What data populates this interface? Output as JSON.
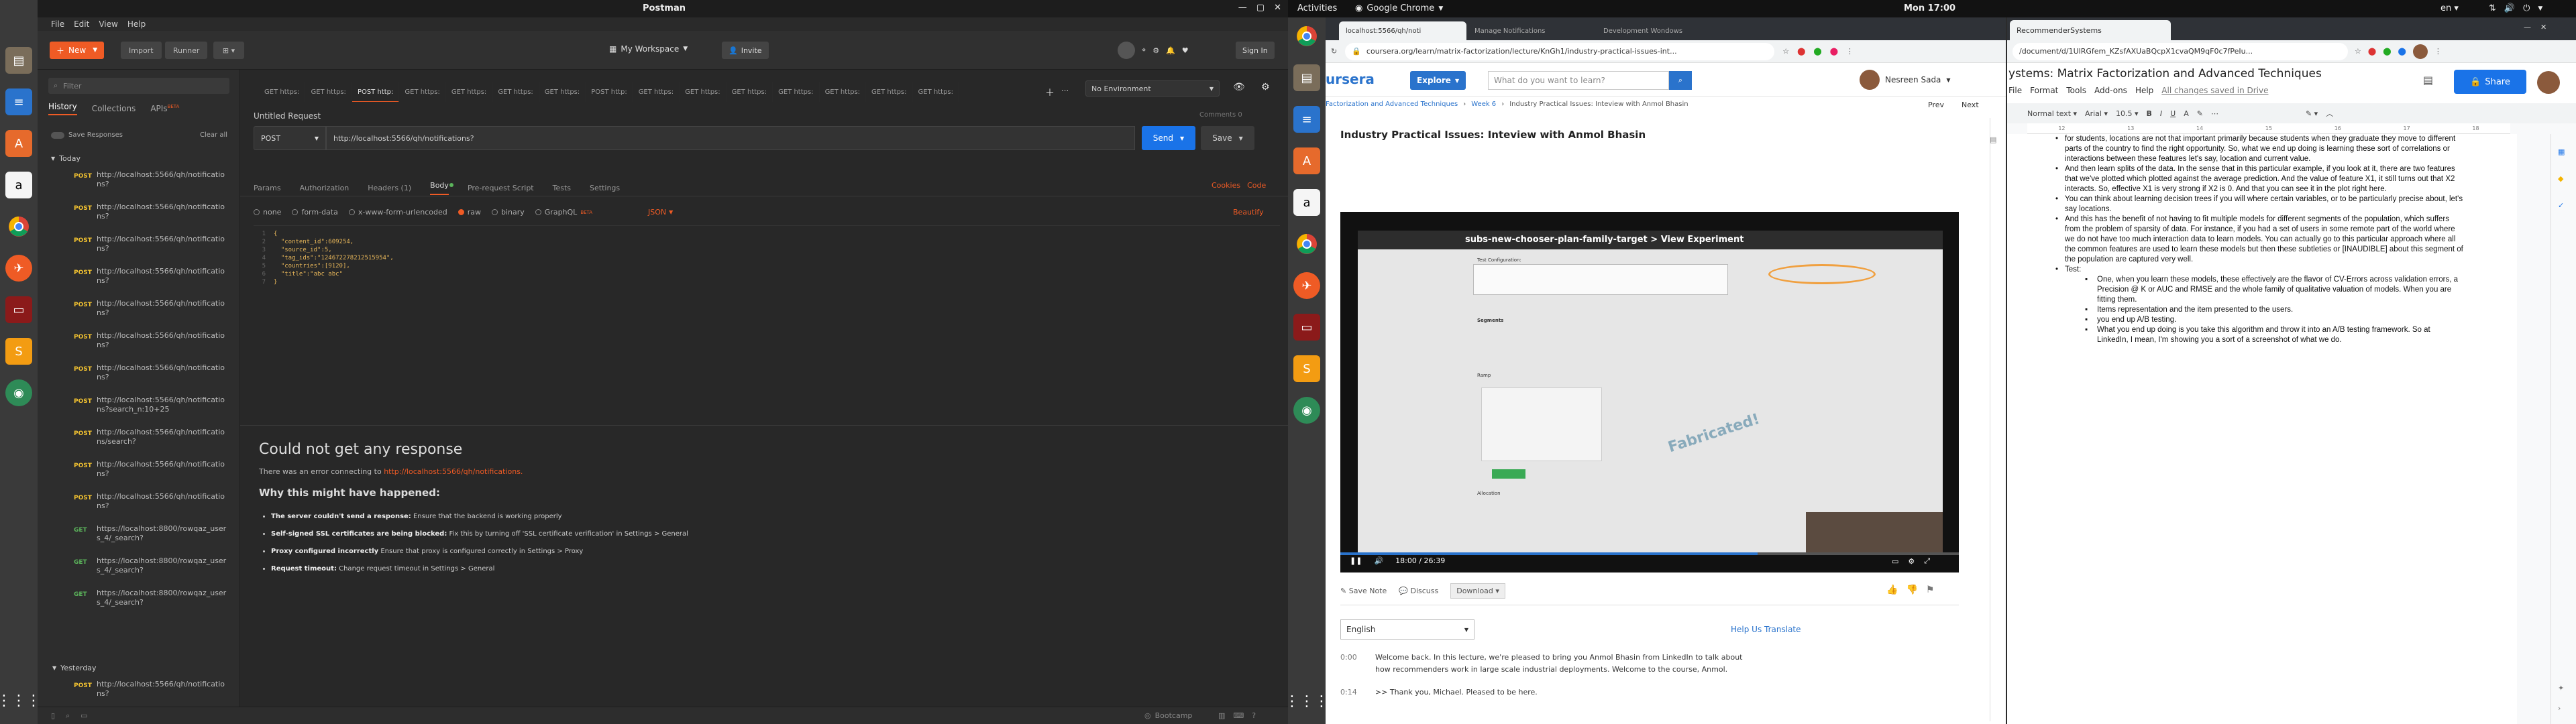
{
  "system": {
    "activities": "Activities",
    "app_menu": "Google Chrome",
    "clock": "Mon 17:00",
    "lang": "en"
  },
  "postman": {
    "title": "Postman",
    "menu": [
      "File",
      "Edit",
      "View",
      "Help"
    ],
    "new_label": "New",
    "import_label": "Import",
    "runner_label": "Runner",
    "workspace": "My Workspace",
    "invite": "Invite",
    "signin": "Sign In",
    "filter_placeholder": "Filter",
    "side_tabs": [
      "History",
      "Collections",
      "APIs"
    ],
    "beta": "BETA",
    "save_responses": "Save Responses",
    "clear_all": "Clear all",
    "today": "Today",
    "yesterday": "Yesterday",
    "history": [
      {
        "method": "POST",
        "url": "http://localhost:5566/qh/notificatio ns?"
      },
      {
        "method": "POST",
        "url": "http://localhost:5566/qh/notificatio ns?"
      },
      {
        "method": "POST",
        "url": "http://localhost:5566/qh/notificatio ns?"
      },
      {
        "method": "POST",
        "url": "http://localhost:5566/qh/notificatio ns?"
      },
      {
        "method": "POST",
        "url": "http://localhost:5566/qh/notificatio ns?"
      },
      {
        "method": "POST",
        "url": "http://localhost:5566/qh/notificatio ns?"
      },
      {
        "method": "POST",
        "url": "http://localhost:5566/qh/notificatio ns?"
      },
      {
        "method": "POST",
        "url": "http://localhost:5566/qh/notificatio ns?search_n:10+25"
      },
      {
        "method": "POST",
        "url": "http://localhost:5566/qh/notificatio ns/search?"
      },
      {
        "method": "POST",
        "url": "http://localhost:5566/qh/notificatio ns?"
      },
      {
        "method": "POST",
        "url": "http://localhost:5566/qh/notificatio ns?"
      },
      {
        "method": "GET",
        "url": "https://localhost:8800/rowqaz_user s_4/_search?"
      },
      {
        "method": "GET",
        "url": "https://localhost:8800/rowqaz_user s_4/_search?"
      },
      {
        "method": "GET",
        "url": "https://localhost:8800/rowqaz_user s_4/_search?"
      }
    ],
    "yesterday_item": {
      "method": "POST",
      "url": "http://localhost:5566/qh/notificatio ns?"
    },
    "tabs": [
      "GET https:",
      "GET https:",
      "POST http:",
      "GET https:",
      "GET https:",
      "GET https:",
      "GET https:",
      "POST http:",
      "GET https:",
      "GET https:",
      "GET https:",
      "GET https:",
      "GET https:",
      "GET https:",
      "GET https:"
    ],
    "environment": "No Environment",
    "request_name": "Untitled Request",
    "comments": "Comments 0",
    "method": "POST",
    "url": "http://localhost:5566/qh/notifications?",
    "send": "Send",
    "save": "Save",
    "req_tabs": [
      "Params",
      "Authorization",
      "Headers (1)",
      "Body",
      "Pre-request Script",
      "Tests",
      "Settings"
    ],
    "cookies": "Cookies",
    "code": "Code",
    "body_types": [
      "none",
      "form-data",
      "x-www-form-urlencoded",
      "raw",
      "binary",
      "GraphQL"
    ],
    "graphql_beta": "BETA",
    "json": "JSON",
    "beautify": "Beautify",
    "code_lines": [
      "{",
      "  \"content_id\":609254,",
      "  \"source_id\":5,",
      "  \"tag_ids\":\"124672278212515954\",",
      "  \"countries\":[9120],",
      "  \"title\":\"abc abc\"",
      "}"
    ],
    "line_numbers": [
      "1",
      "2",
      "3",
      "4",
      "5",
      "6",
      "7"
    ],
    "error_title": "Could not get any response",
    "error_line_prefix": "There was an error connecting to ",
    "error_link": "http://localhost:5566/qh/notifications.",
    "why_title": "Why this might have happened:",
    "reasons": [
      {
        "b": "The server couldn't send a response:",
        "t": " Ensure that the backend is working properly"
      },
      {
        "b": "Self-signed SSL certificates are being blocked:",
        "t": " Fix this by turning off 'SSL certificate verification' in Settings > General"
      },
      {
        "b": "Proxy configured incorrectly",
        "t": " Ensure that proxy is configured correctly in Settings > Proxy"
      },
      {
        "b": "Request timeout:",
        "t": " Change request timeout in Settings > General"
      }
    ],
    "bootcamp": "Bootcamp"
  },
  "chrome": {
    "tabs": [
      "localhost:5566/qh/noti",
      "Manage Notifications",
      "Development Wondows",
      "RecommenderSystems"
    ],
    "url": "coursera.org/learn/matrix-factorization/lecture/KnGh1/industry-practical-issues-int...",
    "logo": "ursera",
    "explore": "Explore",
    "search_placeholder": "What do you want to learn?",
    "user": "Nesreen Sada",
    "breadcrumb": [
      "Factorization and Advanced Techniques",
      "Week 6",
      "Industry Practical Issues: Inteview with Anmol Bhasin"
    ],
    "prev": "Prev",
    "next": "Next",
    "lecture_title": "Industry Practical Issues: Inteview with Anmol Bhasin",
    "video_header": "subs-new-chooser-plan-family-target > View Experiment",
    "video_labels": [
      "Test Configuration:",
      "Segments",
      "Ramp",
      "Allocation"
    ],
    "video_watermark": "Fabricated!",
    "time": "18:00 / 26:39",
    "progress": 0.675,
    "save_note": "Save Note",
    "discuss": "Discuss",
    "download": "Download",
    "language": "English",
    "help_translate": "Help Us Translate",
    "captions": [
      {
        "time": "0:00",
        "text": "Welcome back. In this lecture, we're pleased to bring you Anmol Bhasin from LinkedIn to talk about how recommenders work in large scale industrial deployments. Welcome to the course, Anmol."
      },
      {
        "time": "0:14",
        "text": ">> Thank you, Michael. Pleased to be here."
      }
    ]
  },
  "docs": {
    "url": "/document/d/1UlRGfem_KZsfAXUaBQcpX1cvaQM9qF0c7fPeIu...",
    "title": "ystems: Matrix Factorization and Advanced Techniques",
    "menu": [
      "File",
      "Format",
      "Tools",
      "Add-ons",
      "Help"
    ],
    "saved": "All changes saved in Drive",
    "share": "Share",
    "style": "Normal text",
    "font": "Arial",
    "size": "10.5",
    "ruler": [
      "12",
      "13",
      "14",
      "15",
      "16",
      "17",
      "18"
    ],
    "paras": [
      "for students, locations are not that important primarily because students when they graduate they move to different parts of the country to find the right opportunity. So, what we end up doing is learning these sort of correlations or interactions between these features let's say, location and current value.",
      "And then learn splits of the data. In the sense that in this particular example, if you look at it, there are two features that we've plotted which plotted against the average prediction. And the value of feature X1, it still turns out that X2 interacts. So, effective X1 is very strong if X2 is 0. And that you can see it in the plot right here.",
      "You can think about learning decision trees if you will where certain variables, or to be particularly precise about, let's say locations.",
      "And this has the benefit of not having to fit multiple models for different segments of the population, which suffers from the problem of sparsity of data. For instance, if you had a set of users in some remote part of the world where we do not have too much interaction data to learn models. You can actually go to this particular approach where all the common features are used to learn these models but then these subtleties or [INAUDIBLE] about this segment of the population are captured very well.",
      "Test:"
    ],
    "subbullets": [
      "One, when you learn these models, these effectively are the flavor of CV-Errors across validation errors, a Precision @ K or AUC and RMSE and the whole family of qualitative valuation of models. When you are fitting them.",
      "Items representation and the item presented to the users.",
      " you end up A/B testing.",
      "What you end up doing is you take this algorithm and throw it into an A/B testing framework. So at LinkedIn, I mean, I'm showing you a sort of a screenshot of what we do."
    ]
  },
  "colors": {
    "accent": "#ef5b25",
    "coursera": "#2a73cc",
    "docs_blue": "#1a73e8",
    "send": "#1a73e8"
  }
}
